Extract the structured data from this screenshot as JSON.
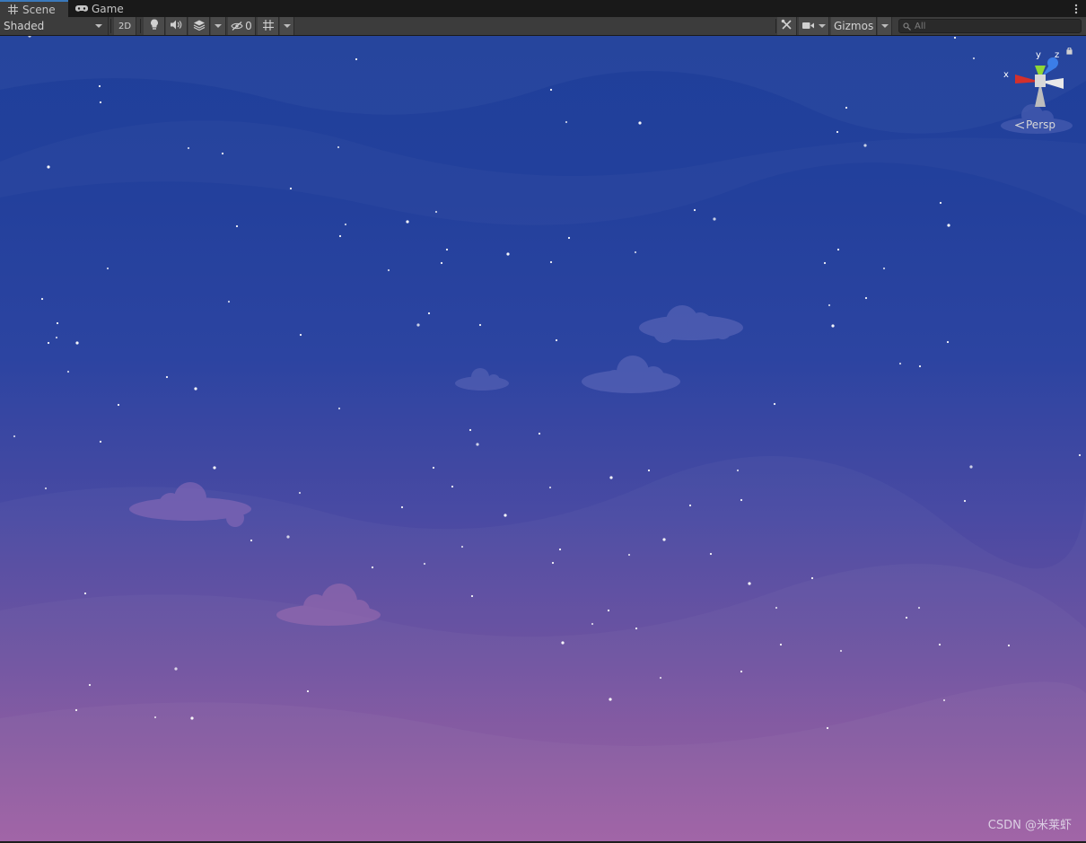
{
  "tabs": [
    {
      "label": "Scene",
      "icon": "scene-grid-icon",
      "active": true
    },
    {
      "label": "Game",
      "icon": "gamepad-icon",
      "active": false
    }
  ],
  "toolbar": {
    "shading_mode": "Shaded",
    "mode_2d_label": "2D",
    "hidden_count": "0",
    "gizmos_label": "Gizmos",
    "search_placeholder": "All"
  },
  "gizmo": {
    "x_label": "x",
    "y_label": "y",
    "z_label": "z",
    "projection_label": "Persp"
  },
  "watermark": "CSDN @米莱虾",
  "colors": {
    "sky_top": "#1f3f9a",
    "sky_bottom": "#9856a0",
    "axis_x": "#d3302c",
    "axis_y": "#8fd635",
    "axis_z": "#3b7de8",
    "tab_accent": "#3a79bb"
  }
}
